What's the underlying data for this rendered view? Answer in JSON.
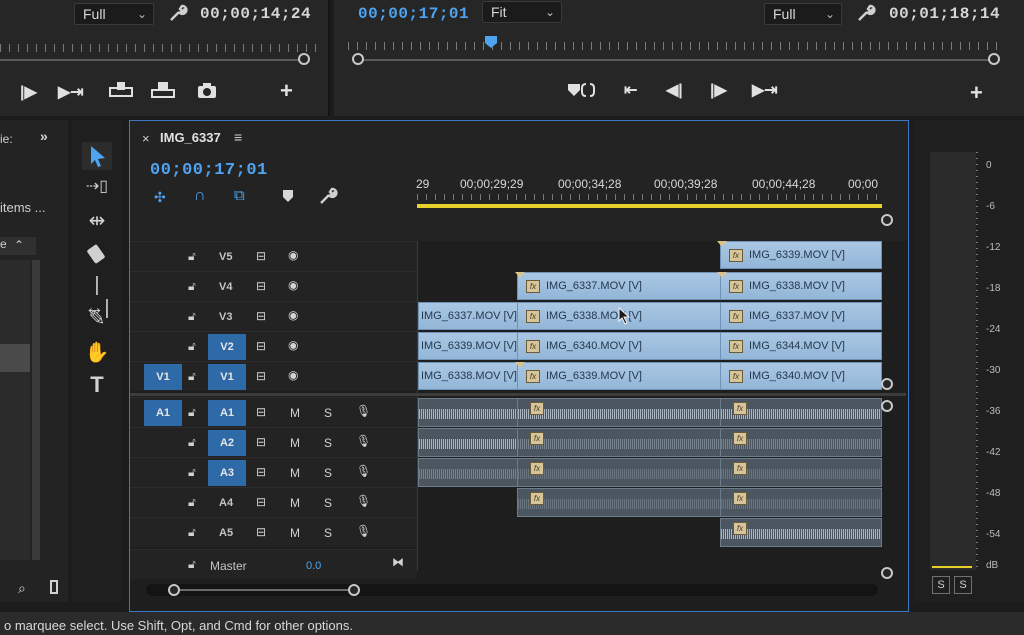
{
  "source_monitor": {
    "zoom": "Full",
    "timecode": "00;00;14;24"
  },
  "program_monitor": {
    "current_timecode": "00;00;17;01",
    "zoom": "Fit",
    "quality": "Full",
    "duration_timecode": "00;01;18;14"
  },
  "project_panel": {
    "title_fragment": "ie:",
    "items_label": "items ..."
  },
  "timeline": {
    "tab_title": "IMG_6337",
    "close_glyph": "×",
    "menu_glyph": "≡",
    "playhead_timecode": "00;00;17;01",
    "ruler_labels": [
      "29",
      "00;00;29;29",
      "00;00;34;28",
      "00;00;39;28",
      "00;00;44;28",
      "00;00"
    ],
    "video_tracks": [
      {
        "label": "V5",
        "target": ""
      },
      {
        "label": "V4",
        "target": ""
      },
      {
        "label": "V3",
        "target": ""
      },
      {
        "label": "V2",
        "target": "V2"
      },
      {
        "label": "V1",
        "target": "V1",
        "source": "V1"
      }
    ],
    "audio_tracks": [
      {
        "label": "A1",
        "target": "A1",
        "source": "A1"
      },
      {
        "label": "A2",
        "target": "A2"
      },
      {
        "label": "A3",
        "target": "A3"
      },
      {
        "label": "A4",
        "target": ""
      },
      {
        "label": "A5",
        "target": ""
      }
    ],
    "mute_label": "M",
    "solo_label": "S",
    "master_label": "Master",
    "master_value": "0.0",
    "clips": {
      "v5_c": "IMG_6339.MOV [V]",
      "v4_b": "IMG_6337.MOV [V]",
      "v4_c": "IMG_6338.MOV [V]",
      "v3_a": "IMG_6337.MOV [V]",
      "v3_b": "IMG_6338.MOV [V]",
      "v3_c": "IMG_6337.MOV [V]",
      "v2_a": "IMG_6339.MOV [V]",
      "v2_b": "IMG_6340.MOV [V]",
      "v2_c": "IMG_6344.MOV [V]",
      "v1_a": "IMG_6338.MOV [V]",
      "v1_b": "IMG_6339.MOV [V]",
      "v1_c": "IMG_6340.MOV [V]"
    },
    "fx_label": "fx"
  },
  "audio_meter": {
    "scale": [
      "0",
      "-6",
      "-12",
      "-18",
      "-24",
      "-30",
      "-36",
      "-42",
      "-48",
      "-54",
      "dB"
    ],
    "solo_labels": [
      "S",
      "S"
    ]
  },
  "status_bar": {
    "text": "o marquee select. Use Shift, Opt, and Cmd for other options."
  },
  "colors": {
    "accent_blue": "#4ea4f0",
    "selection_border": "#3b78c4",
    "target_blue": "#2f6aa8",
    "clip_fill": "#a9c7e3",
    "work_area_yellow": "#e6d22b"
  }
}
